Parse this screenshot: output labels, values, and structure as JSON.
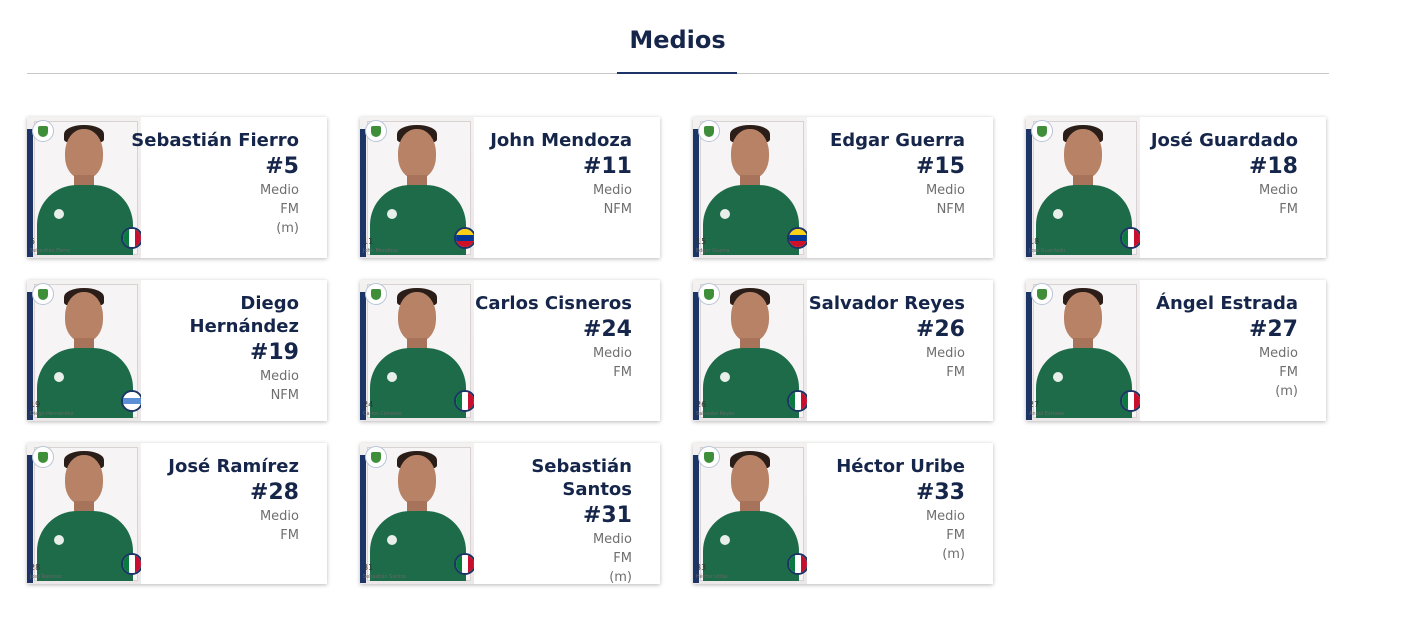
{
  "section": {
    "title": "Medios"
  },
  "colors": {
    "navy": "#16264a",
    "accent": "#1c3566",
    "shirt_green": "#1d6b49"
  },
  "players": [
    {
      "name": "Sebastián Fierro",
      "number": "#5",
      "position": "Medio",
      "foot": "FM",
      "extra": "(m)",
      "caption_number": "5",
      "caption_name": "Sebastián Fierro",
      "flag": "mexico-flag-icon"
    },
    {
      "name": "John Mendoza",
      "number": "#11",
      "position": "Medio",
      "foot": "NFM",
      "extra": "",
      "caption_number": "11",
      "caption_name": "John Mendoza",
      "flag": "colombia-flag-icon"
    },
    {
      "name": "Edgar Guerra",
      "number": "#15",
      "position": "Medio",
      "foot": "NFM",
      "extra": "",
      "caption_number": "15",
      "caption_name": "Edgar Guerra",
      "flag": "colombia-flag-icon"
    },
    {
      "name": "José Guardado",
      "number": "#18",
      "position": "Medio",
      "foot": "FM",
      "extra": "",
      "caption_number": "18",
      "caption_name": "José Guardado",
      "flag": "mexico-flag-icon"
    },
    {
      "name": "Diego Hernández",
      "number": "#19",
      "position": "Medio",
      "foot": "NFM",
      "extra": "",
      "caption_number": "19",
      "caption_name": "Diego Hernández",
      "flag": "uruguay-flag-icon"
    },
    {
      "name": "Carlos Cisneros",
      "number": "#24",
      "position": "Medio",
      "foot": "FM",
      "extra": "",
      "caption_number": "24",
      "caption_name": "Carlos Cisneros",
      "flag": "mexico-flag-icon"
    },
    {
      "name": "Salvador Reyes",
      "number": "#26",
      "position": "Medio",
      "foot": "FM",
      "extra": "",
      "caption_number": "26",
      "caption_name": "Salvador Reyes",
      "flag": "mexico-flag-icon"
    },
    {
      "name": "Ángel Estrada",
      "number": "#27",
      "position": "Medio",
      "foot": "FM",
      "extra": "(m)",
      "caption_number": "27",
      "caption_name": "Ángel Estrada",
      "flag": "mexico-flag-icon"
    },
    {
      "name": "José Ramírez",
      "number": "#28",
      "position": "Medio",
      "foot": "FM",
      "extra": "",
      "caption_number": "28",
      "caption_name": "José Ramírez",
      "flag": "mexico-flag-icon"
    },
    {
      "name": "Sebastián Santos",
      "number": "#31",
      "position": "Medio",
      "foot": "FM",
      "extra": "(m)",
      "caption_number": "31",
      "caption_name": "Sebastián Santos",
      "flag": "mexico-flag-icon"
    },
    {
      "name": "Héctor Uribe",
      "number": "#33",
      "position": "Medio",
      "foot": "FM",
      "extra": "(m)",
      "caption_number": "33",
      "caption_name": "Héctor Uribe",
      "flag": "mexico-flag-icon"
    }
  ]
}
